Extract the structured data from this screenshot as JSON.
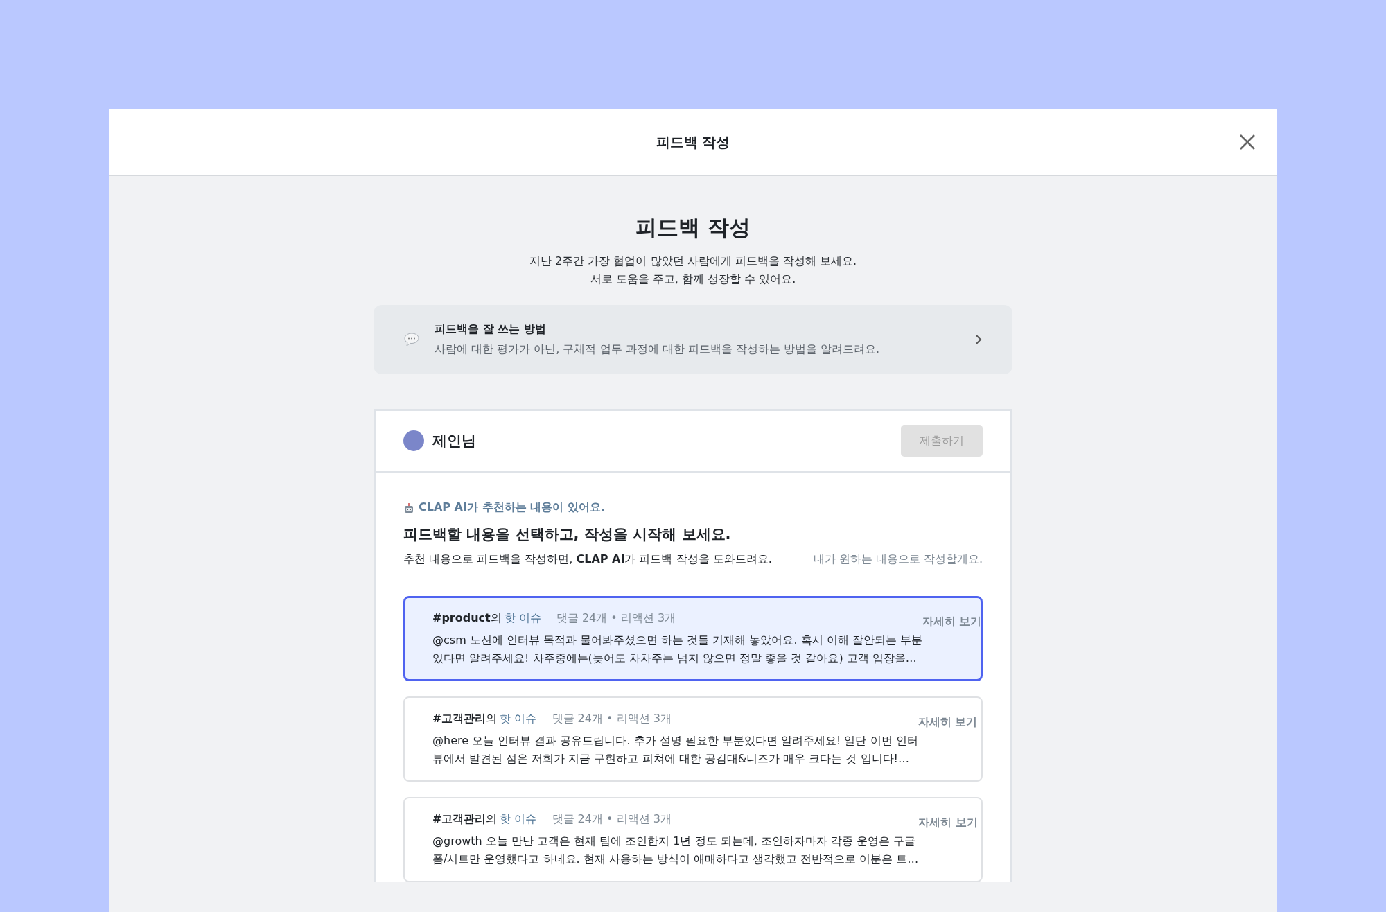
{
  "modal": {
    "title": "피드백 작성"
  },
  "intro": {
    "heading": "피드백 작성",
    "lines": [
      "지난 2주간 가장 협업이 많았던 사람에게 피드백을 작성해 보세요.",
      "서로 도움을 주고, 함께 성장할 수 있어요."
    ]
  },
  "guide": {
    "title": "피드백을 잘 쓰는 방법",
    "description": "사람에 대한 평가가 아닌, 구체적 업무 과정에 대한 피드백을 작성하는 방법을 알려드려요."
  },
  "recipient": {
    "name": "제인님",
    "submit": {
      "label": "제출하기",
      "disabled": true
    }
  },
  "recommendation": {
    "badge": "CLAP AI가 추천하는 내용이 있어요.",
    "heading": "피드백할 내용을 선택하고, 작성을 시작해 보세요.",
    "description": "추천 내용으로 피드백을 작성하면, **CLAP AI**가 피드백 작성을 도와드려요.",
    "own_link": "내가 원하는 내용으로 작성할게요."
  },
  "topics": [
    {
      "selected": true,
      "channel": "**#product**의",
      "tag": "핫 이슈",
      "stats": "댓글 24개 • 리액션 3개",
      "lines": [
        "@csm 노션에 인터뷰 목적과 물어봐주셨으면 하는 것들 기재해 놓았어요. 혹시 이해 잘안되는 부분",
        "있다면 알려주세요! 차주중에는(늦어도 차차주는 넘지 않으면 정말 좋을 것 같아요) 고객 입장을…"
      ],
      "detail": "자세히 보기"
    },
    {
      "selected": false,
      "channel": "**#고객관리**의",
      "tag": "핫 이슈",
      "stats": "댓글 24개 • 리액션 3개",
      "lines": [
        "@here 오늘 인터뷰 결과 공유드립니다. 추가 설명 필요한 부분있다면 알려주세요! 일단 이번 인터",
        "뷰에서 발견된 점은 저희가 지금 구현하고 피쳐에 대한 공감대&니즈가 매우 크다는 것 입니다!…"
      ],
      "detail": "자세히 보기"
    },
    {
      "selected": false,
      "channel": "**#고객관리**의",
      "tag": "핫 이슈",
      "stats": "댓글 24개 • 리액션 3개",
      "lines": [
        "@growth 오늘 만난 고객은 현재 팀에 조인한지 1년 정도 되는데, 조인하자마자 각종 운영은 구글",
        "폼/시트만 운영했다고 하네요. 현재 사용하는 방식이 애매하다고 생각했고 전반적으로 이분은 트…"
      ],
      "detail": "자세히 보기"
    }
  ]
}
